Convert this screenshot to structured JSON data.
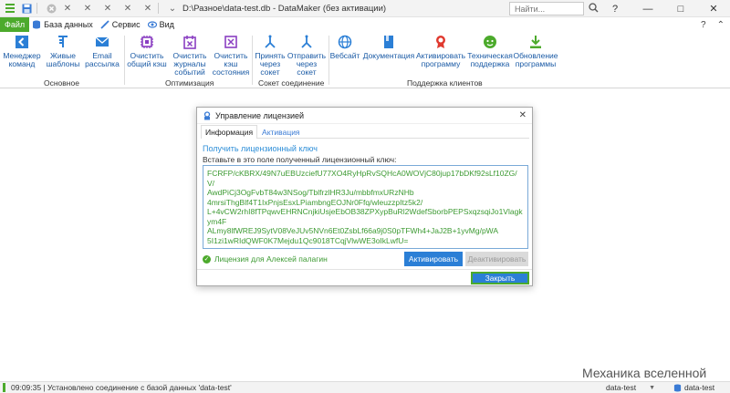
{
  "titlebar": {
    "path": "D:\\Разное\\data-test.db - DataMaker (без активации)",
    "search_placeholder": "Найти...",
    "help": "?",
    "minimize": "—",
    "maximize": "□",
    "close": "✕"
  },
  "menubar": {
    "file": "Файл",
    "database": "База данных",
    "service": "Сервис",
    "view": "Вид",
    "help": "?"
  },
  "ribbon": {
    "buttons": [
      {
        "label": "Менеджер\nкоманд",
        "icon": "command-manager-icon"
      },
      {
        "label": "Живые\nшаблоны",
        "icon": "live-templates-icon"
      },
      {
        "label": "Email\nрассылка",
        "icon": "email-icon"
      },
      {
        "label": "Очистить\nобщий кэш",
        "icon": "cpu-icon"
      },
      {
        "label": "Очистить\nжурналы\nсобытий",
        "icon": "clear-log-icon"
      },
      {
        "label": "Очистить\nкэш\nсостояния",
        "icon": "clear-state-icon"
      },
      {
        "label": "Принять\nчерез\nсокет",
        "icon": "socket-receive-icon"
      },
      {
        "label": "Отправить\nчерез\nсокет",
        "icon": "socket-send-icon"
      },
      {
        "label": "Вебсайт",
        "icon": "globe-icon"
      },
      {
        "label": "Документация",
        "icon": "book-icon"
      },
      {
        "label": "Активировать\nпрограмму",
        "icon": "award-icon"
      },
      {
        "label": "Техническая\nподдержка",
        "icon": "support-icon"
      },
      {
        "label": "Обновление\nпрограммы",
        "icon": "download-icon"
      }
    ],
    "groups": [
      "Основное",
      "Оптимизация",
      "Сокет соединение",
      "Поддержка клиентов"
    ]
  },
  "dialog": {
    "title": "Управление лицензией",
    "close": "✕",
    "tabs": [
      "Информация",
      "Активация"
    ],
    "subheading": "Получить лицензионный ключ",
    "hint": "Вставьте в это поле полученный лицензионный ключ:",
    "license_key": "FCRFP/cKBRX/49N7uEBUzciefU77XO4RyHpRvSQHcA0WOVjC80jup17bDKf92sLf10ZG/V/\nAwdPiCj3OgFvbT84w3NSog/TblfrzlHR3Ju/mbbfmxURzNHb\n4mrsiThgBlf4T1IxPnjsEsxLPiambngEOJNr0Ffq/wleuzzpItz5k2/\nL+4vCW2rhI8fTPqwvEHRNCnjkiUsjeEbOB38ZPXypBuRl2WdefSborbPEPSxqzsqiJo1Vlagkym4F\nALmy8lfWREJ9SytV08VeJUv5NVn6Et0ZsbLf66a9j0S0pTFWh4+JaJ2B+1yvMg/pWA\n5I1zi1wRIdQWF0K7Mejdu1Qc9018TCqjVlwWE3oIkLwfU=",
    "status": "Лицензия для Алексей палагин",
    "activate": "Активировать",
    "deactivate": "Деактивировать",
    "close_button": "Закрыть"
  },
  "watermark": "Механика вселенной",
  "statusbar": {
    "message": "09:09:35 | Установлено соединение с базой данных 'data-test'",
    "db1": "data-test",
    "db2": "data-test",
    "dropdown": "▼"
  },
  "colors": {
    "accent": "#2b7fd6",
    "green": "#4caa2c",
    "link": "#1a5aa5"
  }
}
